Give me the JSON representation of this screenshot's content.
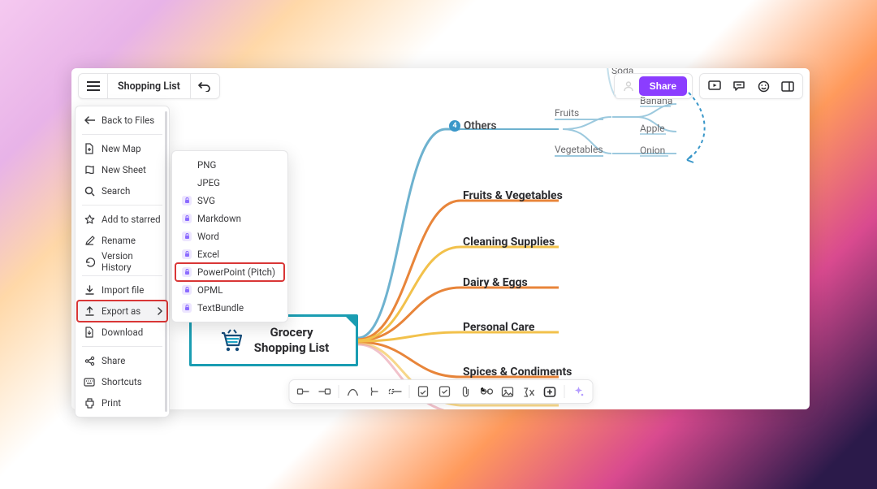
{
  "header": {
    "title": "Shopping List",
    "share_label": "Share"
  },
  "menu": {
    "back": "Back to Files",
    "new_map": "New Map",
    "new_sheet": "New Sheet",
    "search": "Search",
    "add_starred": "Add to starred",
    "rename": "Rename",
    "version_history": "Version History",
    "import": "Import file",
    "export": "Export as",
    "download": "Download",
    "share": "Share",
    "shortcuts": "Shortcuts",
    "print": "Print"
  },
  "export_menu": {
    "png": "PNG",
    "jpeg": "JPEG",
    "svg": "SVG",
    "markdown": "Markdown",
    "word": "Word",
    "excel": "Excel",
    "powerpoint": "PowerPoint (Pitch)",
    "opml": "OPML",
    "textbundle": "TextBundle"
  },
  "mindmap": {
    "root_line1": "Grocery",
    "root_line2": "Shopping List",
    "branches": {
      "soda": "Soda",
      "others": "Others",
      "others_badge": "4",
      "fruits_veg": "Fruits & Vegetables",
      "cleaning": "Cleaning Supplies",
      "dairy": "Dairy & Eggs",
      "personal": "Personal Care",
      "spices": "Spices & Condiments"
    },
    "others_children": {
      "fruits": "Fruits",
      "vegetables": "Vegetables",
      "banana": "Banana",
      "apple": "Apple",
      "onion": "Onion"
    }
  }
}
